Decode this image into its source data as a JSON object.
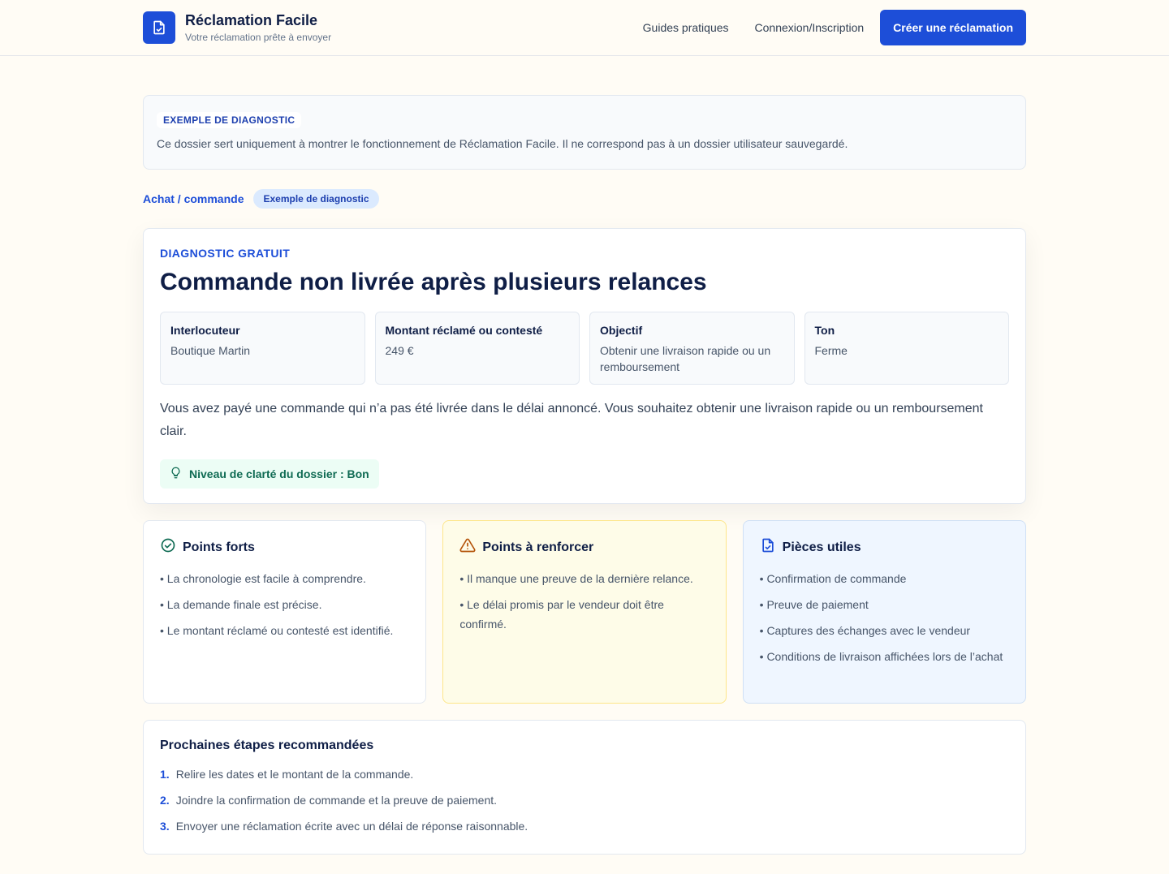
{
  "header": {
    "title": "Réclamation Facile",
    "subtitle": "Votre réclamation prête à envoyer",
    "nav": [
      "Guides pratiques",
      "Connexion/Inscription"
    ],
    "cta": "Créer une réclamation"
  },
  "notice": {
    "tag": "EXEMPLE DE DIAGNOSTIC",
    "text": "Ce dossier sert uniquement à montrer le fonctionnement de Réclamation Facile. Il ne correspond pas à un dossier utilisateur sauvegardé."
  },
  "breadcrumb": {
    "link": "Achat / commande",
    "badge": "Exemple de diagnostic"
  },
  "diagnostic": {
    "kicker": "DIAGNOSTIC GRATUIT",
    "title": "Commande non livrée après plusieurs relances",
    "facts": [
      {
        "label": "Interlocuteur",
        "value": "Boutique Martin"
      },
      {
        "label": "Montant réclamé ou contesté",
        "value": "249 €"
      },
      {
        "label": "Objectif",
        "value": "Obtenir une livraison rapide ou un remboursement"
      },
      {
        "label": "Ton",
        "value": "Ferme"
      }
    ],
    "summary": "Vous avez payé une commande qui n’a pas été livrée dans le délai annoncé. Vous souhaitez obtenir une livraison rapide ou un remboursement clair.",
    "clarity": "Niveau de clarté du dossier : Bon"
  },
  "panels": {
    "strengths": {
      "title": "Points forts",
      "items": [
        "• La chronologie est facile à comprendre.",
        "• La demande finale est précise.",
        "• Le montant réclamé ou contesté est identifié."
      ]
    },
    "improve": {
      "title": "Points à renforcer",
      "items": [
        "• Il manque une preuve de la dernière relance.",
        "• Le délai promis par le vendeur doit être confirmé."
      ]
    },
    "documents": {
      "title": "Pièces utiles",
      "items": [
        "• Confirmation de commande",
        "• Preuve de paiement",
        "• Captures des échanges avec le vendeur",
        "• Conditions de livraison affichées lors de l’achat"
      ]
    }
  },
  "steps": {
    "title": "Prochaines étapes recommandées",
    "items": [
      {
        "num": "1.",
        "text": "Relire les dates et le montant de la commande."
      },
      {
        "num": "2.",
        "text": "Joindre la confirmation de commande et la preuve de paiement."
      },
      {
        "num": "3.",
        "text": "Envoyer une réclamation écrite avec un délai de réponse raisonnable."
      }
    ]
  },
  "colors": {
    "accent": "#1d4ed8",
    "background": "#fffcf5",
    "success": "#0f6b53",
    "warning": "#b45309"
  }
}
